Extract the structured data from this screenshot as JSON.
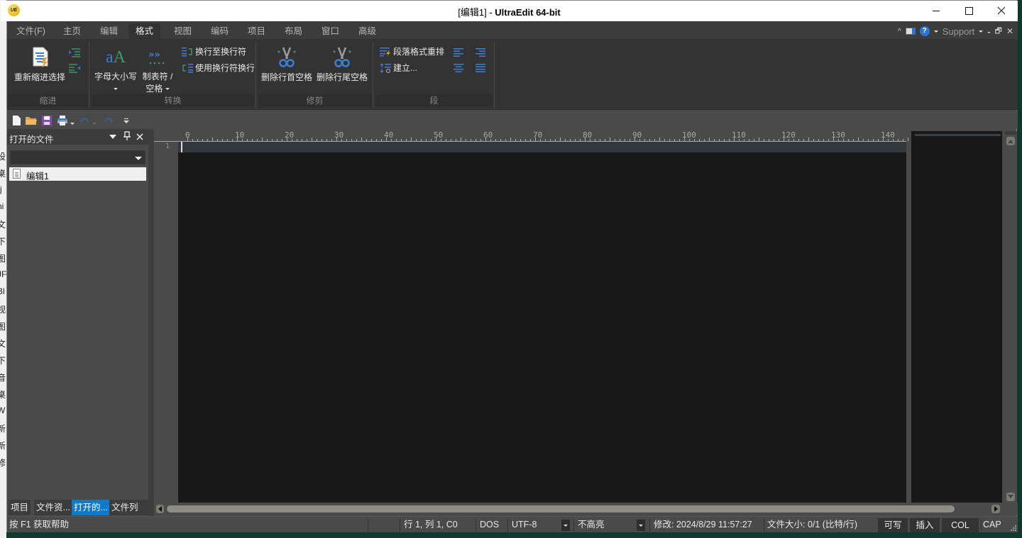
{
  "title_bar": {
    "doc_name": "[编辑1]",
    "separator": " - ",
    "app_name": "UltraEdit 64-bit",
    "app_icon_text": "UE",
    "minimize": "—",
    "maximize": "☐",
    "close": "✕"
  },
  "background_window_chars": [
    "设",
    "桌",
    "rj",
    "ni",
    "文",
    "下",
    "图",
    "JF",
    "Bl",
    "视",
    "图",
    "文",
    "下",
    "音",
    "桌",
    "W",
    "新",
    "新",
    "修"
  ],
  "menu_tabs": [
    {
      "label": "文件(F)",
      "active": false
    },
    {
      "label": "主页",
      "active": false
    },
    {
      "label": "编辑",
      "active": false
    },
    {
      "label": "格式",
      "active": true
    },
    {
      "label": "视图",
      "active": false
    },
    {
      "label": "编码",
      "active": false
    },
    {
      "label": "项目",
      "active": false
    },
    {
      "label": "布局",
      "active": false
    },
    {
      "label": "窗口",
      "active": false
    },
    {
      "label": "高级",
      "active": false
    }
  ],
  "menu_right": {
    "collapse": "^",
    "help": "?",
    "support": "Support",
    "min": "-",
    "restore": "🗗",
    "close": "✕"
  },
  "ribbon": {
    "groups": [
      {
        "label": "缩进",
        "buttons": [
          "重新缩进选择"
        ]
      },
      {
        "label": "转换",
        "buttons": [
          "字母大小写",
          "制表符 /",
          "空格",
          "换行至换行符",
          "使用换行符换行"
        ]
      },
      {
        "label": "修剪",
        "buttons": [
          "删除行首空格",
          "删除行尾空格"
        ]
      },
      {
        "label": "段",
        "buttons": [
          "段落格式重排",
          "建立..."
        ]
      }
    ],
    "case_icon_text": "aA",
    "tab_icon_text": "»»"
  },
  "panel": {
    "title": "打开的文件",
    "combo_value": "",
    "files": [
      "编辑1"
    ],
    "tabs": [
      {
        "label": "项目",
        "active": false
      },
      {
        "label": "文件资...",
        "active": false
      },
      {
        "label": "打开的...",
        "active": true
      },
      {
        "label": "文件列表",
        "active": false
      }
    ]
  },
  "editor": {
    "ruler_labels": [
      "0",
      "10",
      "20",
      "30",
      "40",
      "50",
      "60",
      "70",
      "80",
      "90",
      "100",
      "110",
      "120",
      "130",
      "140"
    ],
    "line_numbers": [
      "1"
    ],
    "content": ""
  },
  "status_bar": {
    "help": "按 F1 获取帮助",
    "position": "行 1, 列 1, C0",
    "line_ending": "DOS",
    "encoding": "UTF-8",
    "highlight": "不高亮",
    "modified": "修改:  2024/8/29 11:57:27",
    "file_size": "文件大小:  0/1  (比特/行)",
    "writable": "可写",
    "insert": "插入",
    "col": "COL",
    "cap": "CAP"
  },
  "colors": {
    "accent": "#0f7acc",
    "editor_bg": "#181818",
    "chrome_bg": "#4a4a4a",
    "ribbon_bg": "#333333"
  }
}
